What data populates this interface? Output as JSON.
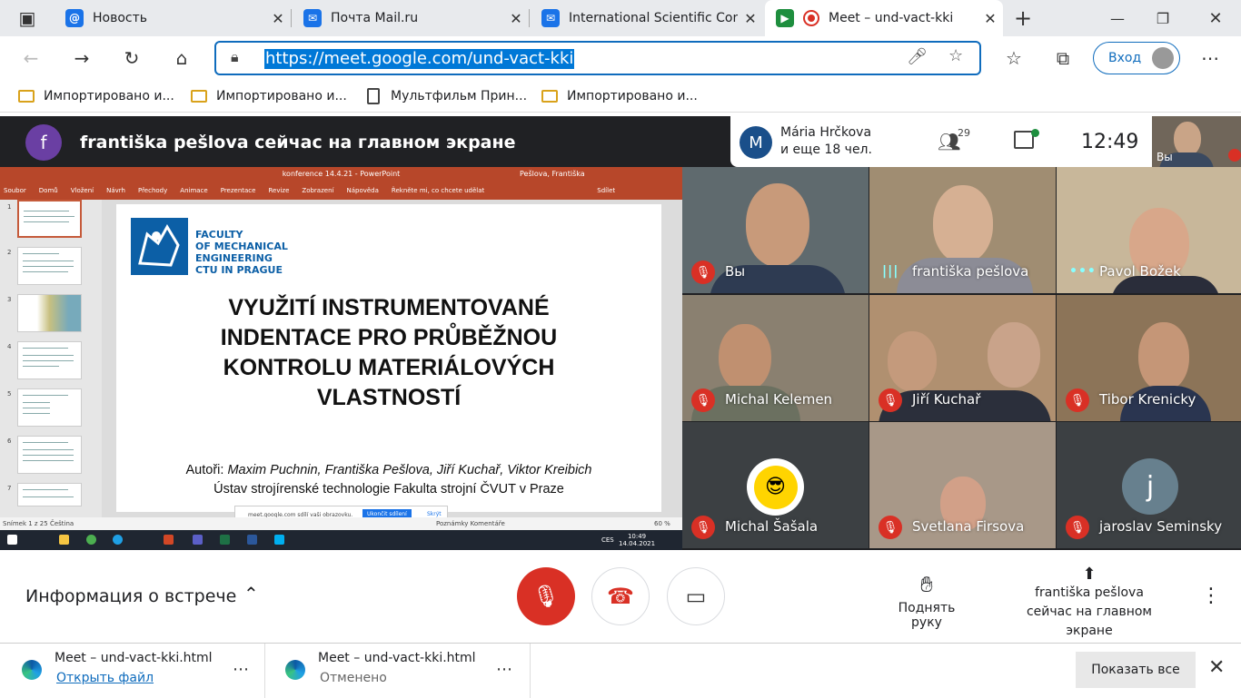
{
  "browser": {
    "tabs": [
      {
        "title": "Новость",
        "icon": "at-icon",
        "color": "#1a73e8"
      },
      {
        "title": "Почта Mail.ru",
        "icon": "mail-icon",
        "color": "#1a73e8"
      },
      {
        "title": "International Scientific Con",
        "icon": "mail-icon",
        "color": "#1a73e8"
      },
      {
        "title": "Meet – und-vact-kki",
        "icon": "meet-icon",
        "color": "#1e8e3e"
      }
    ],
    "url": "https://meet.google.com/und-vact-kki",
    "signin_label": "Вход",
    "bookmarks": [
      {
        "label": "Импортировано и...",
        "icon": "folder-icon"
      },
      {
        "label": "Импортировано и...",
        "icon": "folder-icon"
      },
      {
        "label": "Мультфильм Прин...",
        "icon": "page-icon"
      },
      {
        "label": "Импортировано и...",
        "icon": "folder-icon"
      }
    ]
  },
  "meet": {
    "presenter_initial": "f",
    "banner_text": "františka pešlova сейчас на главном экране",
    "participant_initial": "M",
    "participant_name": "Mária Hrčkova",
    "participant_more": "и еще 18 чел.",
    "people_count": "29",
    "time": "12:49",
    "self_label": "Вы",
    "accent_red": "#d93025",
    "tiles": [
      {
        "name": "Вы",
        "status": "muted"
      },
      {
        "name": "františka pešlova",
        "status": "speaking"
      },
      {
        "name": "Pavol Božek",
        "status": "active"
      },
      {
        "name": "Michal Kelemen",
        "status": "muted"
      },
      {
        "name": "Jiří Kuchař",
        "status": "muted"
      },
      {
        "name": "Tibor Krenicky",
        "status": "muted"
      },
      {
        "name": "Michal Šašala",
        "status": "muted"
      },
      {
        "name": "Svetlana Firsova",
        "status": "muted"
      },
      {
        "name": "jaroslav Seminsky",
        "status": "muted",
        "initial": "j"
      }
    ],
    "meeting_info": "Информация о встрече",
    "raise_hand": "Поднять руку",
    "presenting_line1": "františka pešlova",
    "presenting_line2": "сейчас на главном экране"
  },
  "presentation": {
    "window_title": "konference 14.4.21 - PowerPoint",
    "user": "Pešlova, Františka",
    "ribbon_tabs": [
      "Soubor",
      "Domů",
      "Vložení",
      "Návrh",
      "Přechody",
      "Animace",
      "Prezentace",
      "Revize",
      "Zobrazení",
      "Nápověda",
      "Řekněte mi, co chcete udělat",
      "Sdílet"
    ],
    "logo_text": "FACULTY\nOF MECHANICAL\nENGINEERING\nCTU IN PRAGUE",
    "title_lines": [
      "VYUŽITÍ INSTRUMENTOVANÉ",
      "INDENTACE PRO PRŮBĚŽNOU",
      "KONTROLU MATERIÁLOVÝCH",
      "VLASTNOSTÍ"
    ],
    "authors_label": "Autoři:",
    "authors": "Maxim Puchnin, Františka Pešlova, Jiří Kuchař, Viktor Kreibich",
    "institute": "Ústav strojírenské technologie Fakulta strojní ČVUT v Praze",
    "share_text": "meet.google.com sdílí vaši obrazovku.",
    "share_stop": "Ukončit sdílení",
    "share_hide": "Skrýt",
    "status_left": "Snímek 1 z 25   Čeština",
    "status_right": "Poznámky   Komentáře",
    "zoom": "60 %",
    "taskbar_time": "10:49",
    "taskbar_date": "14.04.2021",
    "taskbar_lang": "CES",
    "slide_numbers": [
      "1",
      "2",
      "3",
      "4",
      "5",
      "6",
      "7"
    ]
  },
  "downloads": [
    {
      "name": "Meet – und-vact-kki.html",
      "sub": "Открыть файл"
    },
    {
      "name": "Meet – und-vact-kki.html",
      "sub": "Отменено"
    }
  ],
  "downloads_show_all": "Показать все"
}
